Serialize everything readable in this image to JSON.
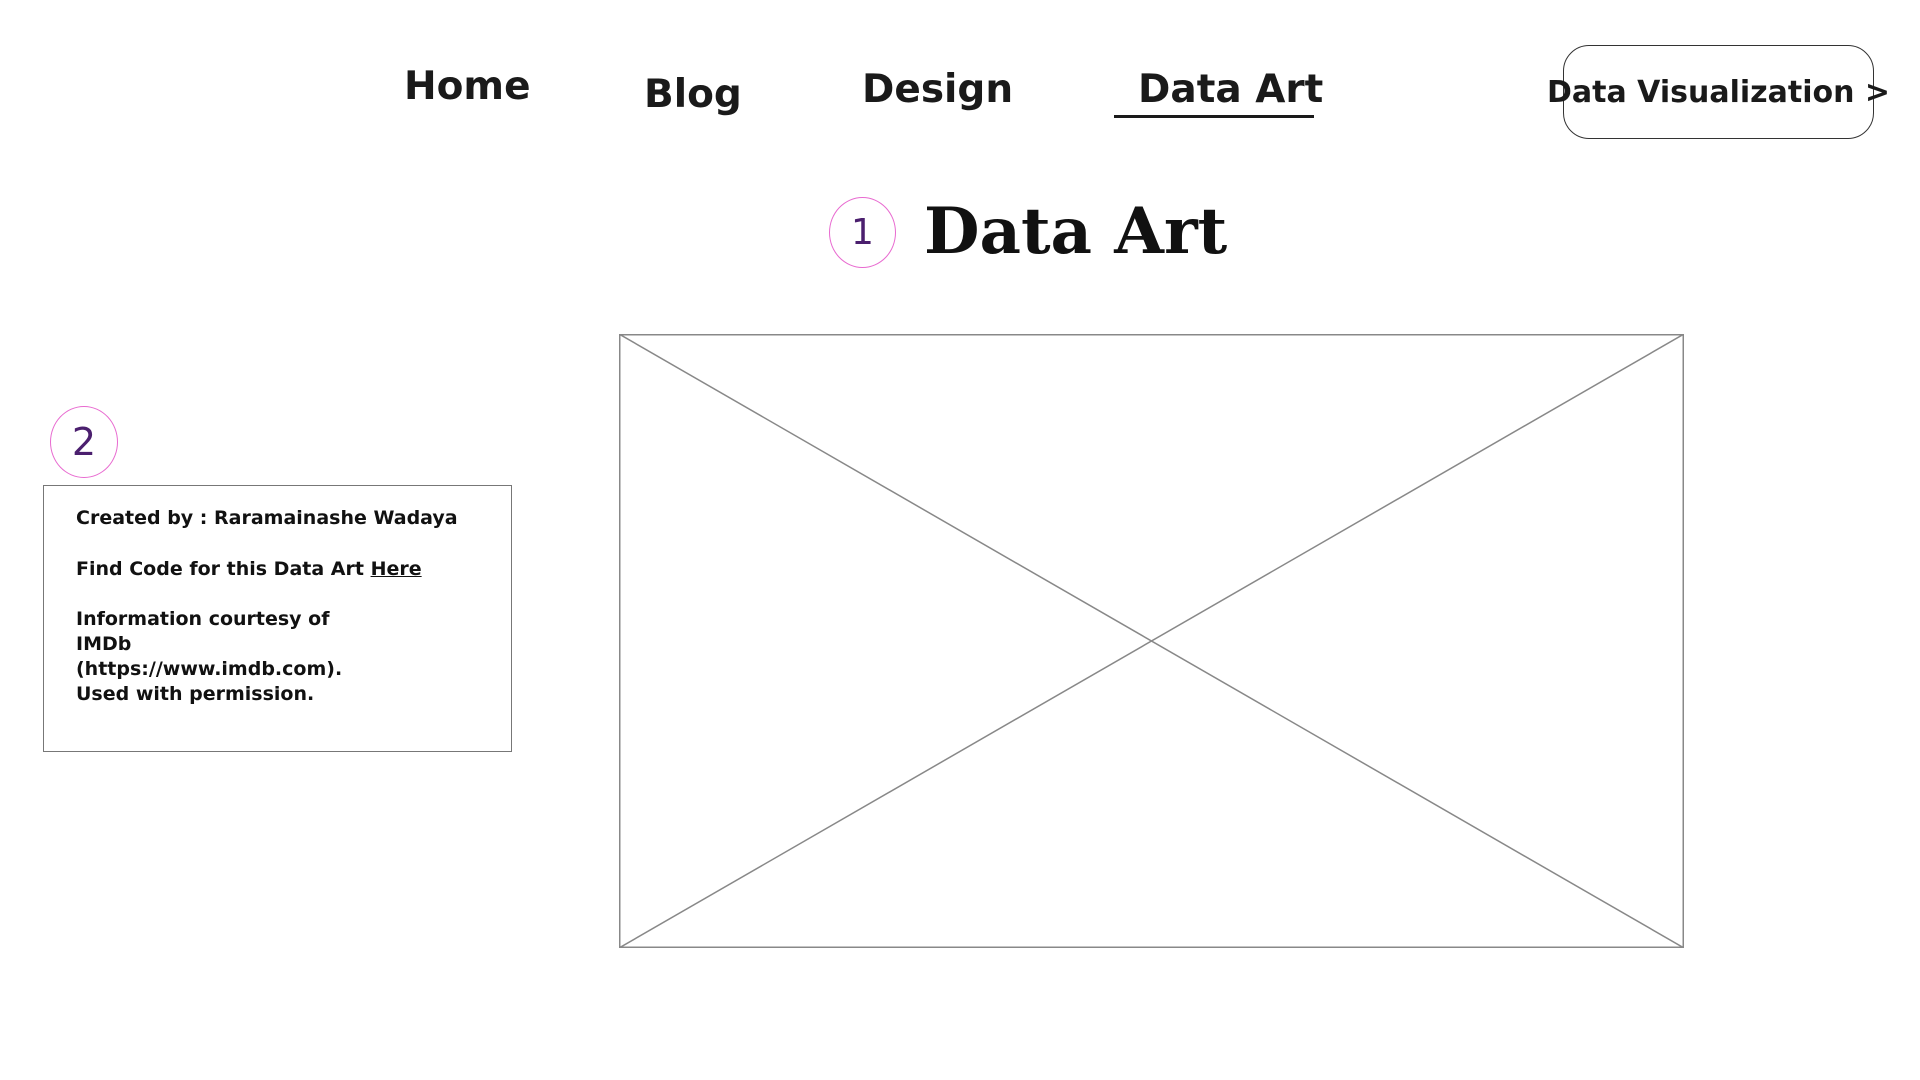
{
  "nav": {
    "items": [
      {
        "label": "Home"
      },
      {
        "label": "Blog"
      },
      {
        "label": "Design"
      },
      {
        "label": "Data Art",
        "active": true
      }
    ],
    "cta_label": "Data Visualization >"
  },
  "annotations": {
    "title_marker": "1",
    "credits_marker": "2"
  },
  "page": {
    "title": "Data Art"
  },
  "credits": {
    "created_by": "Created by : Raramainashe Wadaya",
    "find_code_prefix": "Find Code for this Data Art",
    "find_code_link": "Here",
    "source_lines": [
      "Information courtesy of",
      "IMDb",
      "(https://www.imdb.com).",
      "Used with permission."
    ]
  },
  "colors": {
    "annotation_ring": "#e86ad0",
    "annotation_text": "#4b1f6e",
    "text": "#1a1a1a",
    "placeholder_stroke": "#888888"
  }
}
